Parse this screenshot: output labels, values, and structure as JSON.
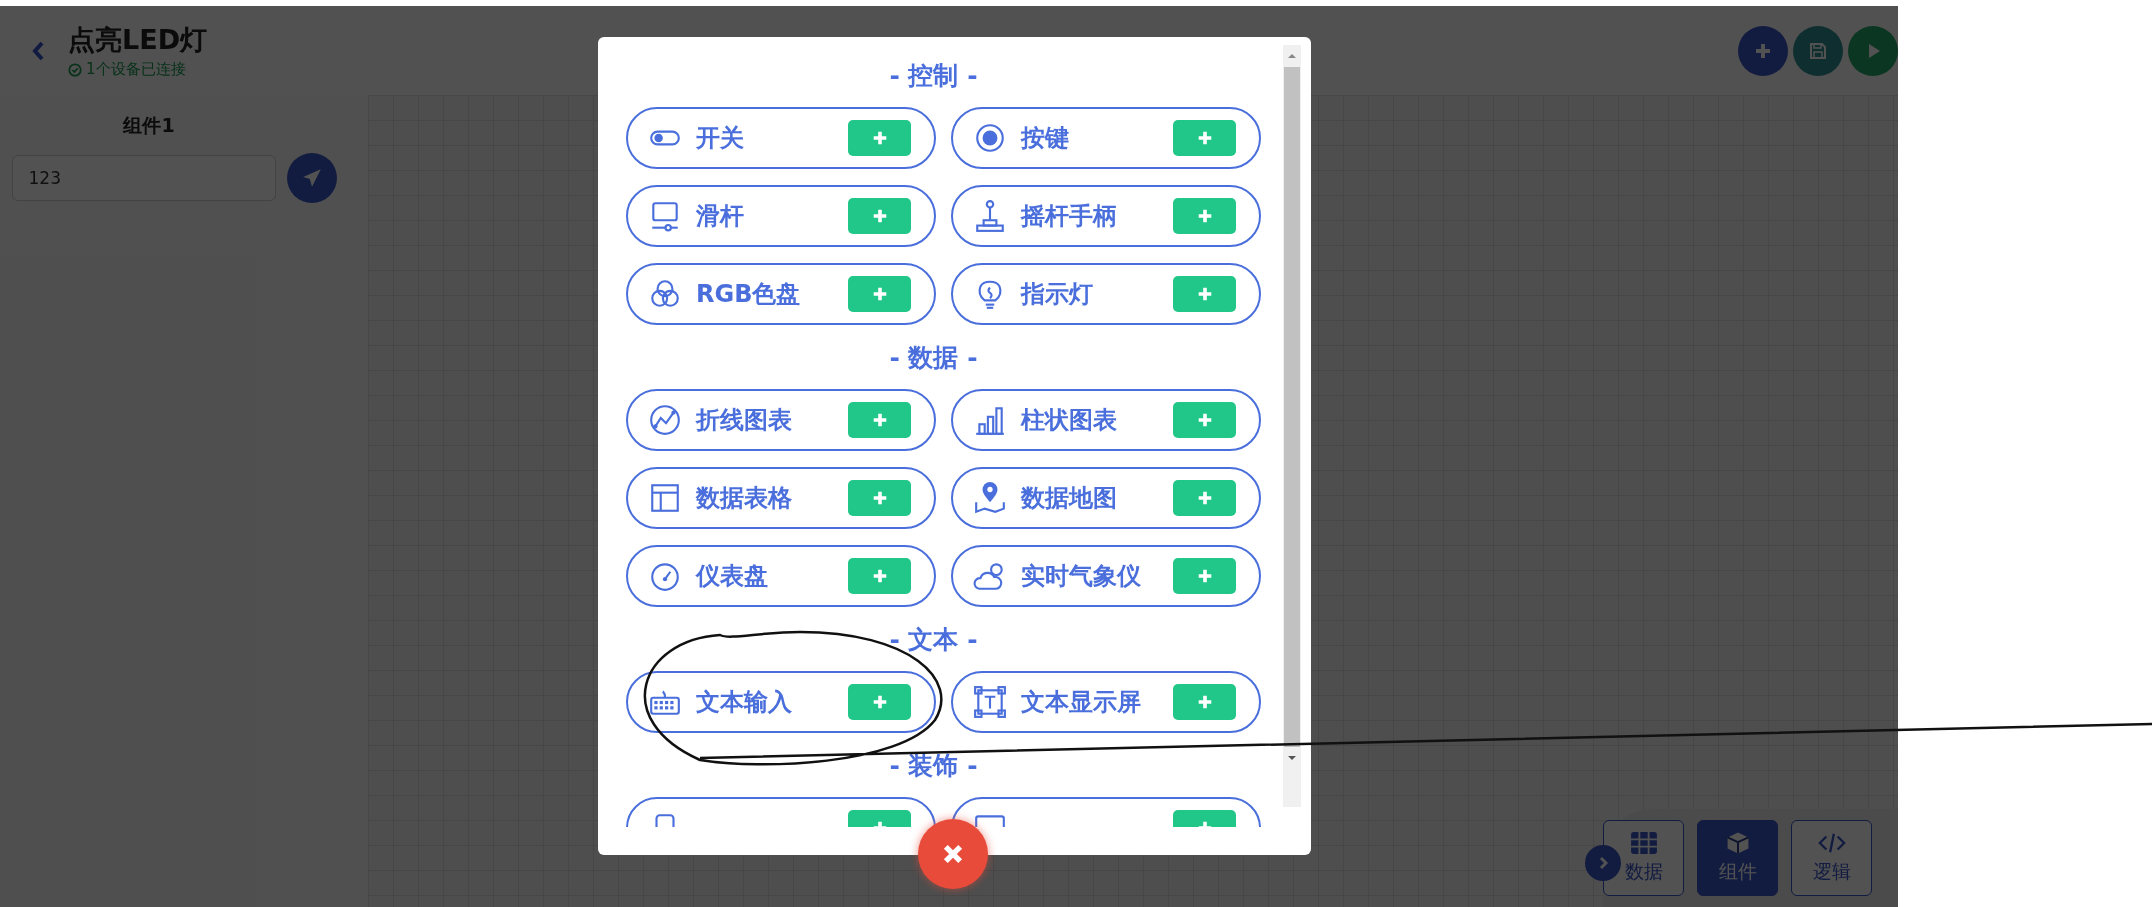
{
  "header": {
    "title": "点亮LED灯",
    "status": "1个设备已连接"
  },
  "widget": {
    "label": "组件1",
    "value": "123"
  },
  "modal": {
    "sections": [
      {
        "title": "- 控制 -",
        "items": [
          {
            "kind": "widget",
            "label": "开关"
          },
          {
            "kind": "widget",
            "label": "按键"
          },
          {
            "kind": "widget",
            "label": "滑杆"
          },
          {
            "kind": "widget",
            "label": "摇杆手柄"
          },
          {
            "kind": "widget",
            "label": "RGB色盘"
          },
          {
            "kind": "widget",
            "label": "指示灯"
          }
        ]
      },
      {
        "title": "- 数据 -",
        "items": [
          {
            "kind": "widget",
            "label": "折线图表"
          },
          {
            "kind": "widget",
            "label": "柱状图表"
          },
          {
            "kind": "widget",
            "label": "数据表格"
          },
          {
            "kind": "widget",
            "label": "数据地图"
          },
          {
            "kind": "widget",
            "label": "仪表盘"
          },
          {
            "kind": "widget",
            "label": "实时气象仪"
          }
        ]
      },
      {
        "title": "- 文本 -",
        "items": [
          {
            "kind": "widget",
            "label": "文本输入"
          },
          {
            "kind": "widget",
            "label": "文本显示屏"
          }
        ]
      },
      {
        "title": "- 装饰 -",
        "items": [
          {
            "kind": "cut_off"
          },
          {
            "kind": "cut_off"
          }
        ]
      }
    ]
  },
  "bottom_tabs": [
    {
      "label": "数据",
      "selected": false
    },
    {
      "label": "组件",
      "selected": true
    },
    {
      "label": "逻辑",
      "selected": false
    }
  ]
}
